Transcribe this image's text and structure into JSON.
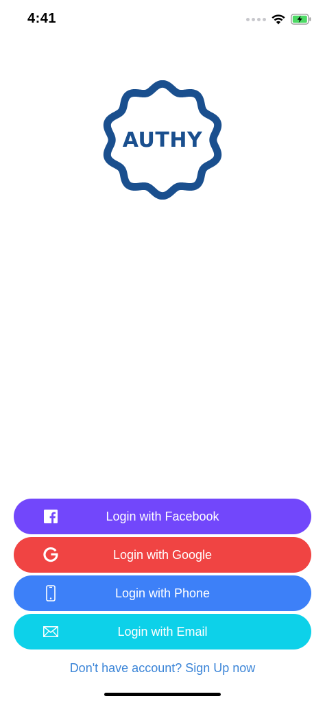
{
  "status_bar": {
    "time": "4:41",
    "icons": [
      "signal-dots-icon",
      "wifi-icon",
      "battery-charging-icon"
    ]
  },
  "logo": {
    "text": "AUTHY",
    "color": "#1a4f8e"
  },
  "buttons": {
    "facebook": {
      "label": "Login with Facebook",
      "icon": "facebook-icon",
      "color": "#7247fb"
    },
    "google": {
      "label": "Login with Google",
      "icon": "google-icon",
      "color": "#f04443"
    },
    "phone": {
      "label": "Login with Phone",
      "icon": "phone-icon",
      "color": "#3d80f8"
    },
    "email": {
      "label": "Login with Email",
      "icon": "email-icon",
      "color": "#0dd1e9"
    }
  },
  "signup": {
    "label": "Don't have account? Sign Up now",
    "color": "#3a84d7"
  }
}
